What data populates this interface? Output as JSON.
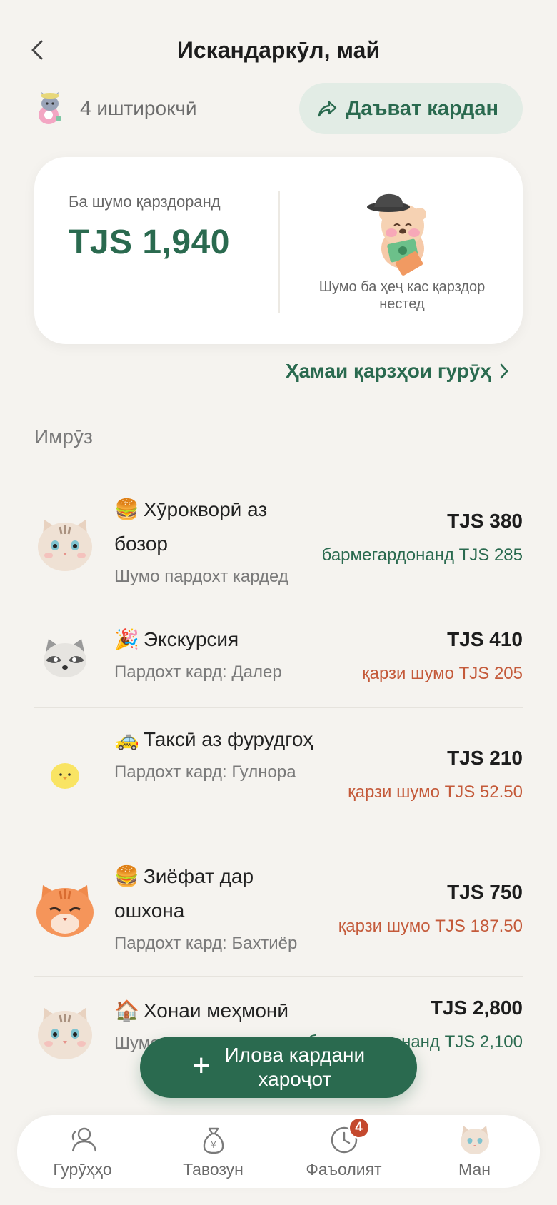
{
  "header": {
    "title": "Искандаркӯл, май"
  },
  "members": {
    "count_label": "4 иштирокчӣ"
  },
  "invite": {
    "label": "Даъват кардан"
  },
  "balance": {
    "caption": "Ба шумо қарздоранд",
    "amount": "TJS 1,940",
    "note": "Шумо ба ҳеҷ кас қарздор нестед"
  },
  "all_debts": {
    "label": "Ҳамаи қарзҳои гурӯҳ"
  },
  "section": {
    "title": "Имрӯз"
  },
  "expenses": [
    {
      "emoji": "🍔",
      "title": "Хӯрокворӣ аз бозор",
      "sub": "Шумо пардохт кардед",
      "amount": "TJS 380",
      "status": "бармегардонанд TJS 285",
      "status_color": "#2a6a4f",
      "avatar": "tabby-cat"
    },
    {
      "emoji": "🎉",
      "title": "Экскурсия",
      "sub": "Пардохт кард: Далер",
      "amount": "TJS 410",
      "status": "қарзи шумо TJS 205",
      "status_color": "#c45a3a",
      "avatar": "raccoon"
    },
    {
      "emoji": "🚕",
      "title": "Таксӣ аз фурудгоҳ",
      "sub": "Пардохт кард: Гулнора",
      "amount": "TJS 210",
      "status": "қарзи шумо TJS 52.50",
      "status_color": "#c45a3a",
      "avatar": "chick"
    },
    {
      "emoji": "🍔",
      "title": "Зиёфат дар ошхона",
      "sub": "Пардохт кард: Бахтиёр",
      "amount": "TJS 750",
      "status": "қарзи шумо TJS 187.50",
      "status_color": "#c45a3a",
      "avatar": "orange-cat"
    },
    {
      "emoji": "🏠",
      "title": "Хонаи меҳмонӣ",
      "sub": "Шумо пардохт кардед",
      "amount": "TJS 2,800",
      "status": "бармегардонанд TJS 2,100",
      "status_color": "#2a6a4f",
      "avatar": "tabby-cat"
    }
  ],
  "fab": {
    "label_line1": "Илова кардани",
    "label_line2": "хароҷот"
  },
  "nav": [
    {
      "label": "Гурӯҳҳо",
      "icon": "groups-icon"
    },
    {
      "label": "Тавозун",
      "icon": "money-bag-icon"
    },
    {
      "label": "Фаъолият",
      "icon": "clock-icon",
      "badge": "4"
    },
    {
      "label": "Ман",
      "icon": "profile-avatar-icon"
    }
  ]
}
